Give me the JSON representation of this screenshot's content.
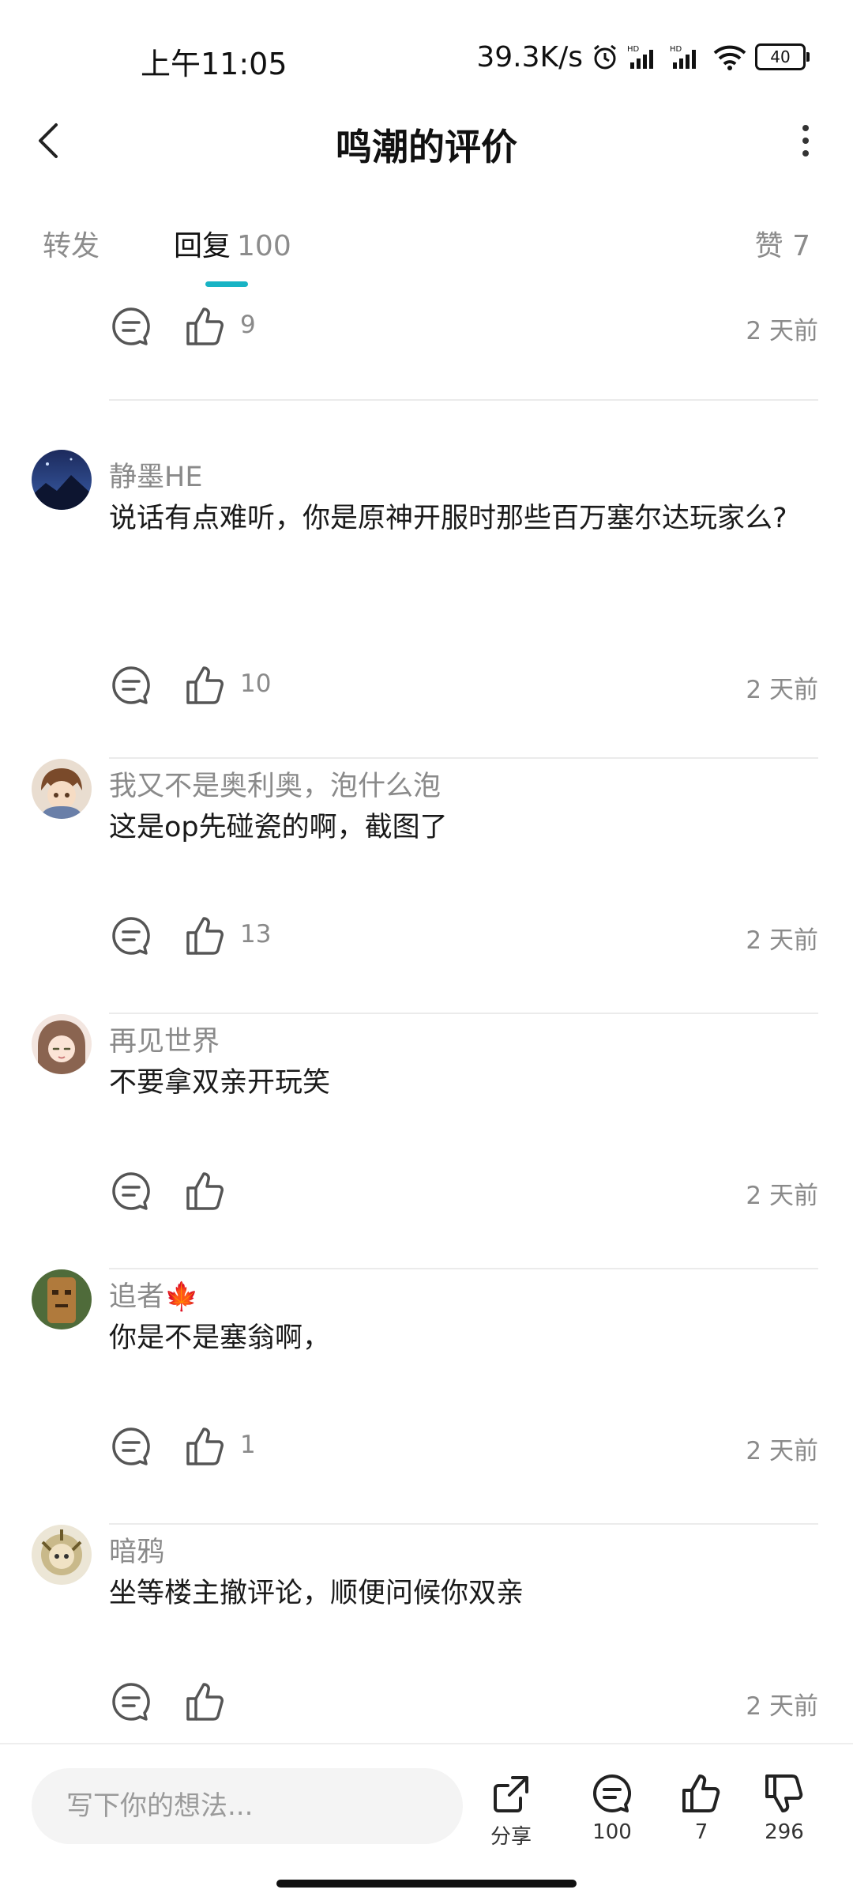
{
  "status_bar": {
    "time": "上午11:05",
    "network_speed": "39.3K/s",
    "battery": "40"
  },
  "header": {
    "title": "鸣潮的评价"
  },
  "tabs": [
    {
      "label": "转发"
    },
    {
      "label": "回复",
      "count": "100"
    },
    {
      "label": "赞",
      "count": "7"
    }
  ],
  "comments": [
    {
      "username": "",
      "content": "",
      "likes": "9",
      "time": "2 天前"
    },
    {
      "username": "静墨HE",
      "content": "说话有点难听，你是原神开服时那些百万塞尔达玩家么?",
      "likes": "10",
      "time": "2 天前"
    },
    {
      "username": "我又不是奥利奥，泡什么泡",
      "content": "这是op先碰瓷的啊，截图了",
      "likes": "13",
      "time": "2 天前"
    },
    {
      "username": "再见世界",
      "content": "不要拿双亲开玩笑",
      "likes": "",
      "time": "2 天前"
    },
    {
      "username": "追者🍁",
      "content": "你是不是塞翁啊，",
      "likes": "1",
      "time": "2 天前"
    },
    {
      "username": "暗鸦",
      "content": "坐等楼主撤评论，顺便问候你双亲",
      "likes": "",
      "time": "2 天前"
    }
  ],
  "bottom_bar": {
    "input_placeholder": "写下你的想法...",
    "share_label": "分享",
    "reply_count": "100",
    "like_count": "7",
    "dislike_count": "296"
  },
  "icons": [
    "back-icon",
    "more-icon",
    "reply-icon",
    "thumb-up-icon",
    "share-icon",
    "thumb-down-icon",
    "alarm-icon",
    "signal-icon",
    "wifi-icon",
    "battery-icon"
  ],
  "colors": {
    "accent": "#18b3c4",
    "text": "#1a1a1a",
    "muted": "#8a8a8a"
  }
}
